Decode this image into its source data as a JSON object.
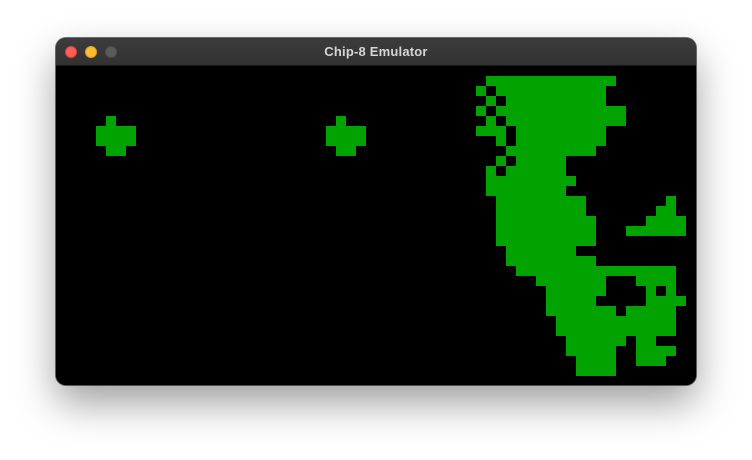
{
  "window": {
    "title": "Chip-8 Emulator"
  },
  "colors": {
    "pixel_on": "#00a300",
    "pixel_off": "#000000",
    "titlebar": "#363636",
    "close_button": "#ff5f57",
    "minimize_button": "#febc2e",
    "zoom_button": "#5b5b5b"
  },
  "icons": {
    "close": "close-button-icon",
    "minimize": "minimize-button-icon",
    "zoom": "zoom-button-icon"
  }
}
